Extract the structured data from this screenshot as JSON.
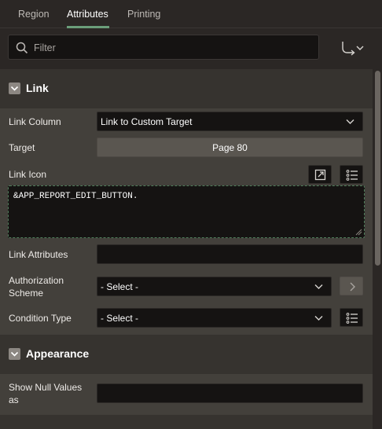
{
  "tabs": [
    {
      "label": "Region"
    },
    {
      "label": "Attributes"
    },
    {
      "label": "Printing"
    }
  ],
  "filter": {
    "placeholder": "Filter"
  },
  "sections": {
    "link": {
      "title": "Link",
      "link_column": {
        "label": "Link Column",
        "value": "Link to Custom Target"
      },
      "target": {
        "label": "Target",
        "value": "Page 80"
      },
      "link_icon": {
        "label": "Link Icon",
        "value": "&APP_REPORT_EDIT_BUTTON."
      },
      "link_attributes": {
        "label": "Link Attributes",
        "value": ""
      },
      "authorization_scheme": {
        "label_line1": "Authorization",
        "label_line2": "Scheme",
        "value": "- Select -"
      },
      "condition_type": {
        "label": "Condition Type",
        "value": "- Select -"
      }
    },
    "appearance": {
      "title": "Appearance",
      "show_null_values": {
        "label_line1": "Show Null Values",
        "label_line2": "as",
        "value": ""
      }
    }
  }
}
